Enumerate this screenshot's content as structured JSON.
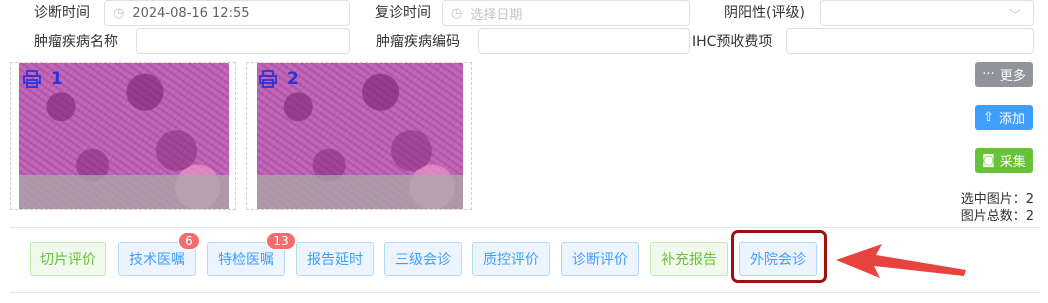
{
  "form": {
    "diagnosis_time_label": "诊断时间",
    "diagnosis_time_value": "2024-08-16 12:55",
    "followup_time_label": "复诊时间",
    "followup_time_placeholder": "选择日期",
    "polarity_label": "阴阳性(评级)",
    "polarity_value": "",
    "tumor_name_label": "肿瘤疾病名称",
    "tumor_name_value": "",
    "tumor_code_label": "肿瘤疾病编码",
    "tumor_code_value": "",
    "ihc_fee_label": "IHC预收费项",
    "ihc_fee_value": ""
  },
  "images": [
    {
      "number": "1"
    },
    {
      "number": "2"
    }
  ],
  "actions": {
    "more": "更多",
    "add": "添加",
    "capture": "采集"
  },
  "stats": {
    "selected": "选中图片：2",
    "total": "图片总数：2"
  },
  "tabs": [
    {
      "label": "切片评价",
      "badge": ""
    },
    {
      "label": "技术医嘱",
      "badge": "6"
    },
    {
      "label": "特检医嘱",
      "badge": "13"
    },
    {
      "label": "报告延时",
      "badge": ""
    },
    {
      "label": "三级会诊",
      "badge": ""
    },
    {
      "label": "质控评价",
      "badge": ""
    },
    {
      "label": "诊断评价",
      "badge": ""
    },
    {
      "label": "补充报告",
      "badge": ""
    },
    {
      "label": "外院会诊",
      "badge": ""
    }
  ],
  "colors": {
    "green_text": "#67c23a",
    "blue_text": "#409eff",
    "badge": "#f56c6c",
    "more_button": "#909399",
    "add_button": "#409eff",
    "capture_button": "#67c23a",
    "annotation": "#e8433f",
    "highlight_border": "#9b1010",
    "image_label": "#2f32d6"
  }
}
